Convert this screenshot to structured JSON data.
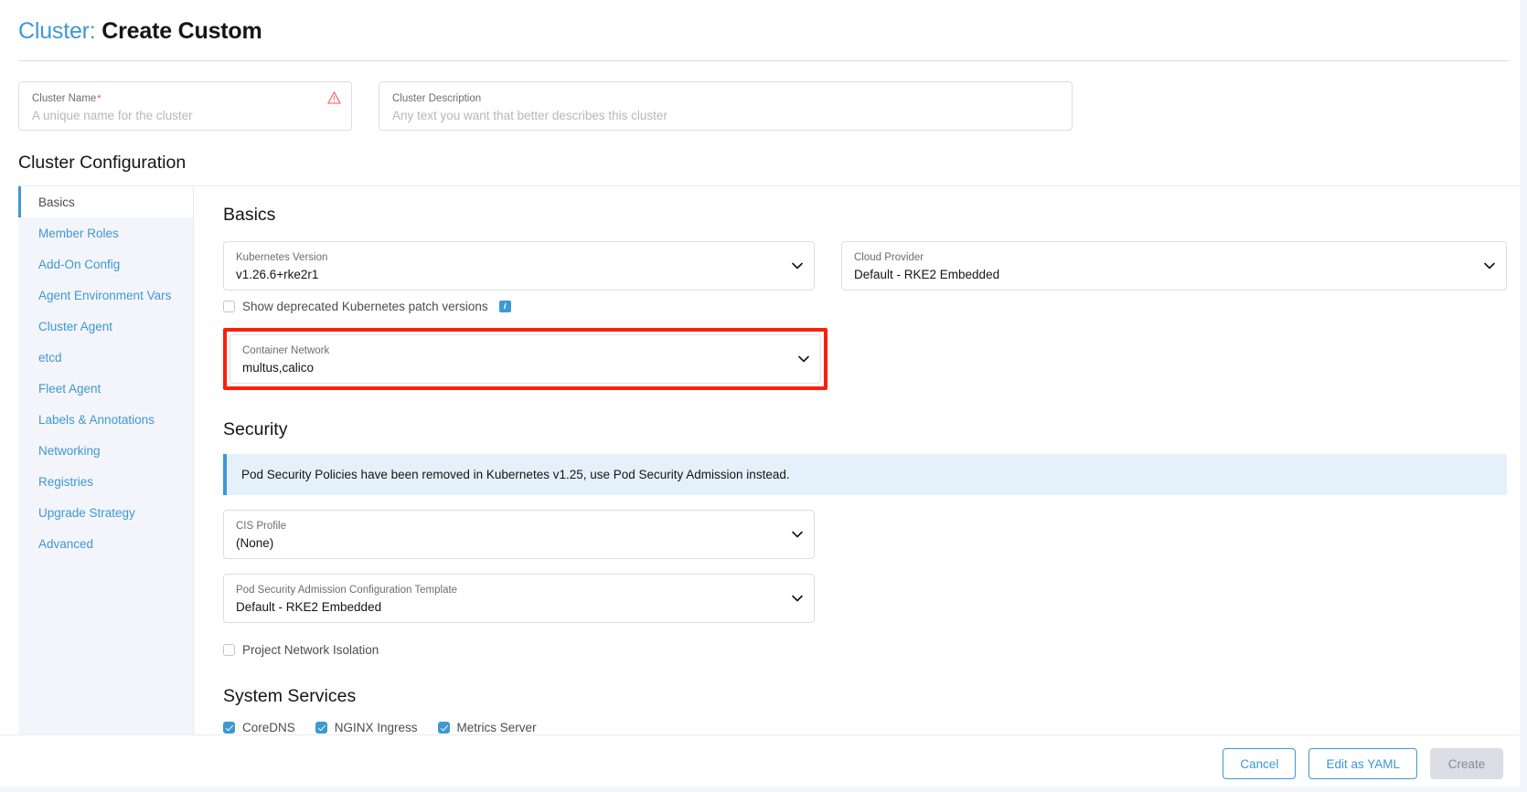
{
  "header": {
    "title_prefix": "Cluster:",
    "title_name": "Create Custom",
    "warning_icon": "warning-triangle-icon"
  },
  "cluster_name_field": {
    "label": "Cluster Name",
    "required_marker": "*",
    "value": "",
    "placeholder": "A unique name for the cluster"
  },
  "cluster_description_field": {
    "label": "Cluster Description",
    "value": "",
    "placeholder": "Any text you want that better describes this cluster"
  },
  "config": {
    "heading": "Cluster Configuration",
    "tabs": [
      {
        "label": "Basics",
        "active": true
      },
      {
        "label": "Member Roles",
        "active": false
      },
      {
        "label": "Add-On Config",
        "active": false
      },
      {
        "label": "Agent Environment Vars",
        "active": false
      },
      {
        "label": "Cluster Agent",
        "active": false
      },
      {
        "label": "etcd",
        "active": false
      },
      {
        "label": "Fleet Agent",
        "active": false
      },
      {
        "label": "Labels & Annotations",
        "active": false
      },
      {
        "label": "Networking",
        "active": false
      },
      {
        "label": "Registries",
        "active": false
      },
      {
        "label": "Upgrade Strategy",
        "active": false
      },
      {
        "label": "Advanced",
        "active": false
      }
    ]
  },
  "basics": {
    "title": "Basics",
    "kubernetes_version": {
      "label": "Kubernetes Version",
      "value": "v1.26.6+rke2r1"
    },
    "cloud_provider": {
      "label": "Cloud Provider",
      "value": "Default - RKE2 Embedded"
    },
    "show_deprecated": {
      "label": "Show deprecated Kubernetes patch versions",
      "checked": false,
      "info_glyph": "i"
    },
    "container_network": {
      "label": "Container Network",
      "value": "multus,calico",
      "highlighted": true,
      "highlight_color": "#fc1f0b"
    }
  },
  "security": {
    "title": "Security",
    "banner_text": "Pod Security Policies have been removed in Kubernetes v1.25, use Pod Security Admission instead.",
    "cis_profile": {
      "label": "CIS Profile",
      "value": "(None)"
    },
    "psa_template": {
      "label": "Pod Security Admission Configuration Template",
      "value": "Default - RKE2 Embedded"
    },
    "project_network_isolation": {
      "label": "Project Network Isolation",
      "checked": false
    }
  },
  "system_services": {
    "title": "System Services",
    "items": [
      {
        "label": "CoreDNS",
        "checked": true
      },
      {
        "label": "NGINX Ingress",
        "checked": true
      },
      {
        "label": "Metrics Server",
        "checked": true
      }
    ]
  },
  "footer": {
    "cancel_label": "Cancel",
    "edit_yaml_label": "Edit as YAML",
    "create_label": "Create"
  },
  "colors": {
    "accent": "#3d98d3",
    "warning": "#f64747",
    "highlight": "#fc1f0b",
    "banner_bg": "#e4f1fb",
    "sidebar_bg": "#f4f5fa"
  }
}
